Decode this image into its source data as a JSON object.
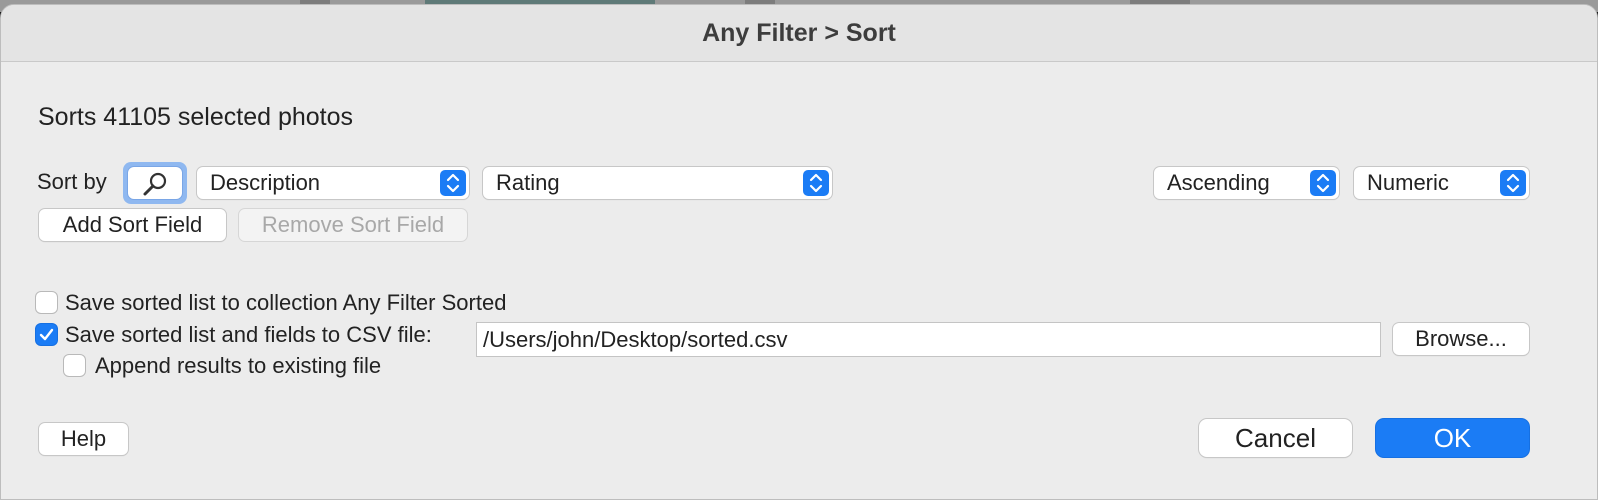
{
  "dialog": {
    "title": "Any Filter > Sort",
    "summary": "Sorts 41105 selected photos"
  },
  "sort": {
    "label": "Sort by",
    "search_icon": "magnifier-icon",
    "field_primary": "Description",
    "field_secondary": "Rating",
    "order": "Ascending",
    "compare_mode": "Numeric",
    "add_label": "Add Sort Field",
    "remove_label": "Remove Sort Field"
  },
  "options": {
    "save_collection_label": "Save sorted list to collection Any Filter Sorted",
    "save_collection_checked": false,
    "save_csv_label": "Save sorted list and fields to CSV file:",
    "save_csv_checked": true,
    "csv_path": "/Users/john/Desktop/sorted.csv",
    "browse_label": "Browse...",
    "append_label": "Append results to existing file",
    "append_checked": false
  },
  "footer": {
    "help_label": "Help",
    "cancel_label": "Cancel",
    "ok_label": "OK"
  },
  "colors": {
    "accent": "#1b7cf5",
    "dialog_bg": "#ececec"
  }
}
